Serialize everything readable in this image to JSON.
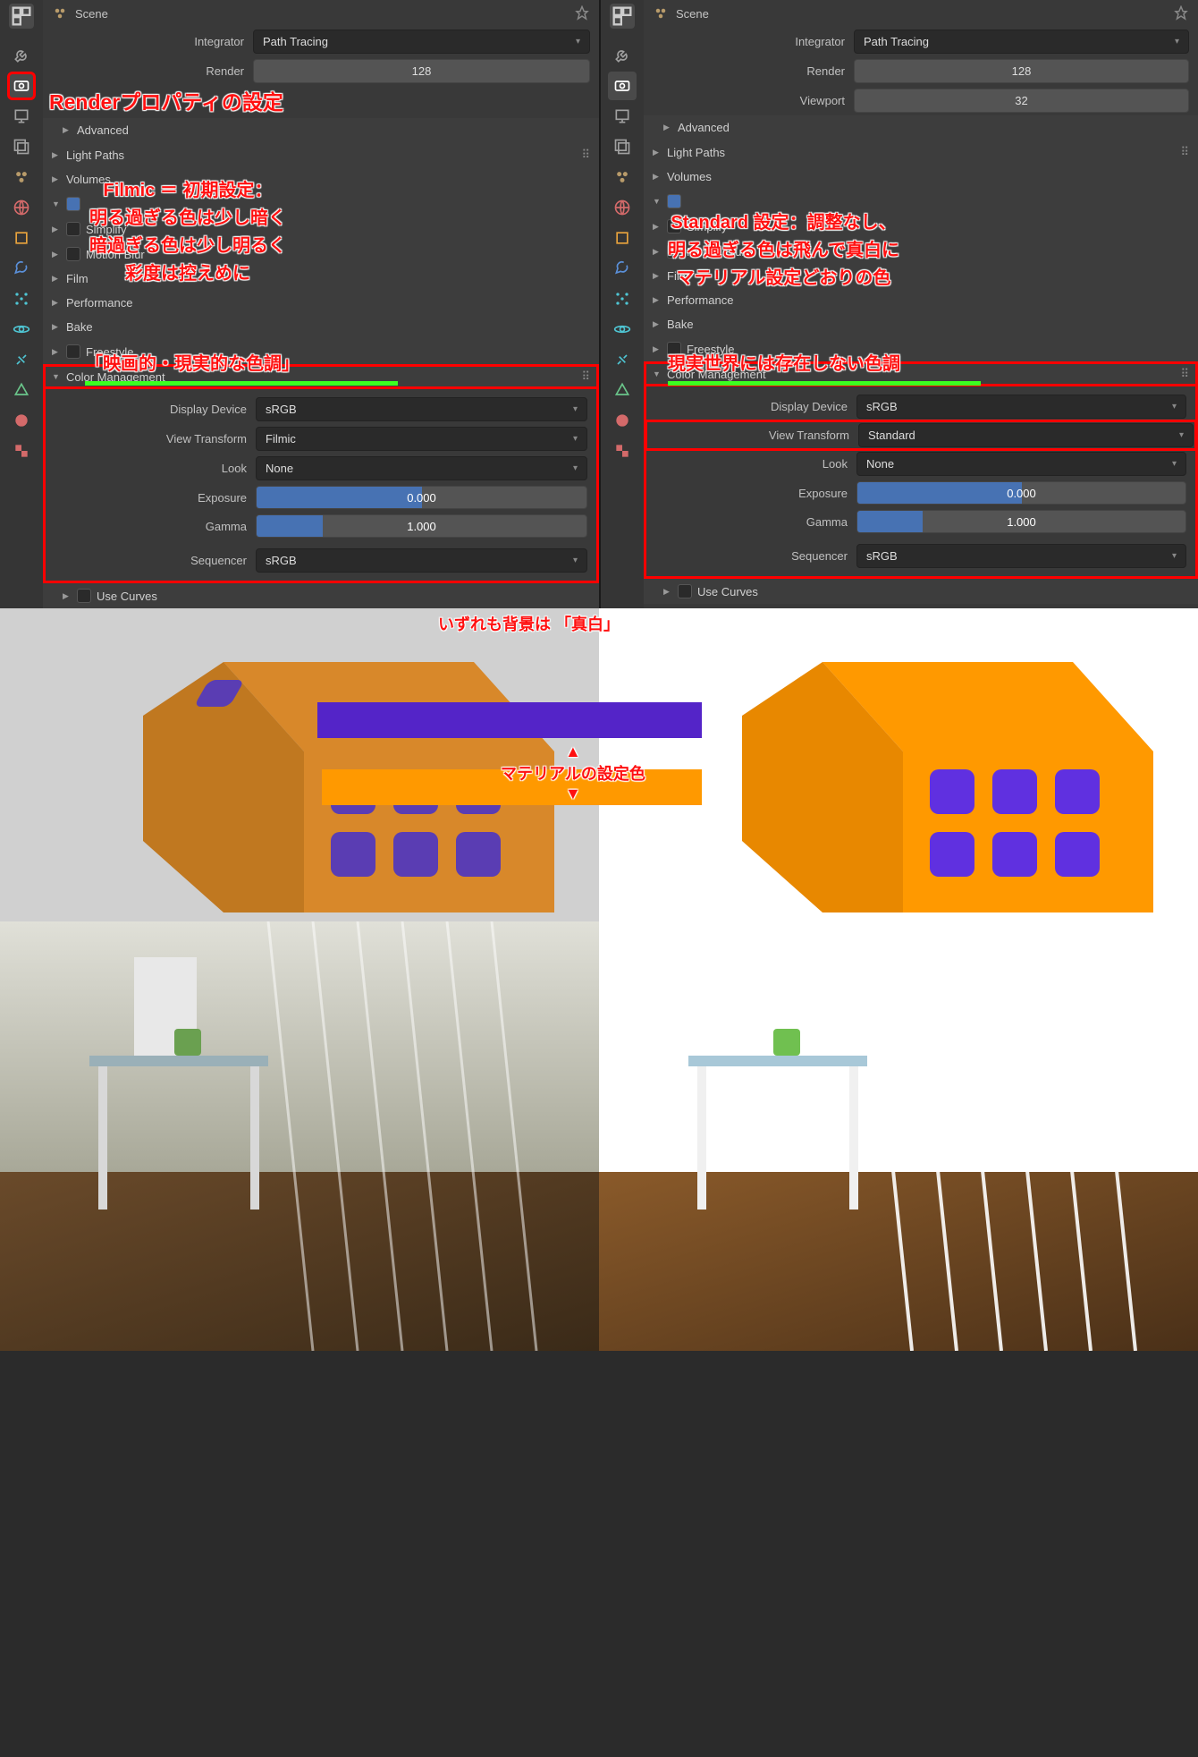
{
  "header": {
    "type": "Scene"
  },
  "integrator": {
    "label": "Integrator",
    "value": "Path Tracing"
  },
  "render": {
    "label": "Render",
    "value": "128"
  },
  "viewport": {
    "label": "Viewport",
    "value": "32"
  },
  "sections": {
    "advanced": "Advanced",
    "light_paths": "Light Paths",
    "volumes": "Volumes",
    "simplify": "Simplify",
    "motion_blur": "Motion Blur",
    "film": "Film",
    "performance": "Performance",
    "bake": "Bake",
    "freestyle": "Freestyle",
    "color_management": "Color Management",
    "use_curves": "Use Curves"
  },
  "cm": {
    "display_device": {
      "label": "Display Device",
      "value": "sRGB"
    },
    "view_transform": {
      "label": "View Transform",
      "left": "Filmic",
      "right": "Standard"
    },
    "look": {
      "label": "Look",
      "value": "None"
    },
    "exposure": {
      "label": "Exposure",
      "value": "0.000",
      "fill_pct": 50
    },
    "gamma": {
      "label": "Gamma",
      "value": "1.000",
      "fill_pct": 20
    },
    "sequencer": {
      "label": "Sequencer",
      "value": "sRGB"
    }
  },
  "annotations": {
    "left_title": "Renderプロパティの設定",
    "left_body": "Filmic ＝ 初期設定：\n明る過ぎる色は少し暗く\n暗過ぎる色は少し明るく\n彩度は控えめに",
    "left_foot": "「映画的・現実的な色調」",
    "right_body": "Standard 設定：調整なし、\n明る過ぎる色は飛んで真白に\nマテリアル設定どおりの色",
    "right_foot": "現実世界には存在しない色調",
    "bg_white": "いずれも背景は 「真白」",
    "mat_color": "マテリアルの設定色"
  },
  "icons": [
    "tool",
    "render",
    "output",
    "view-layer",
    "scene",
    "world",
    "object",
    "modifiers",
    "particles",
    "physics",
    "constraints",
    "data",
    "material",
    "texture",
    "checker"
  ]
}
